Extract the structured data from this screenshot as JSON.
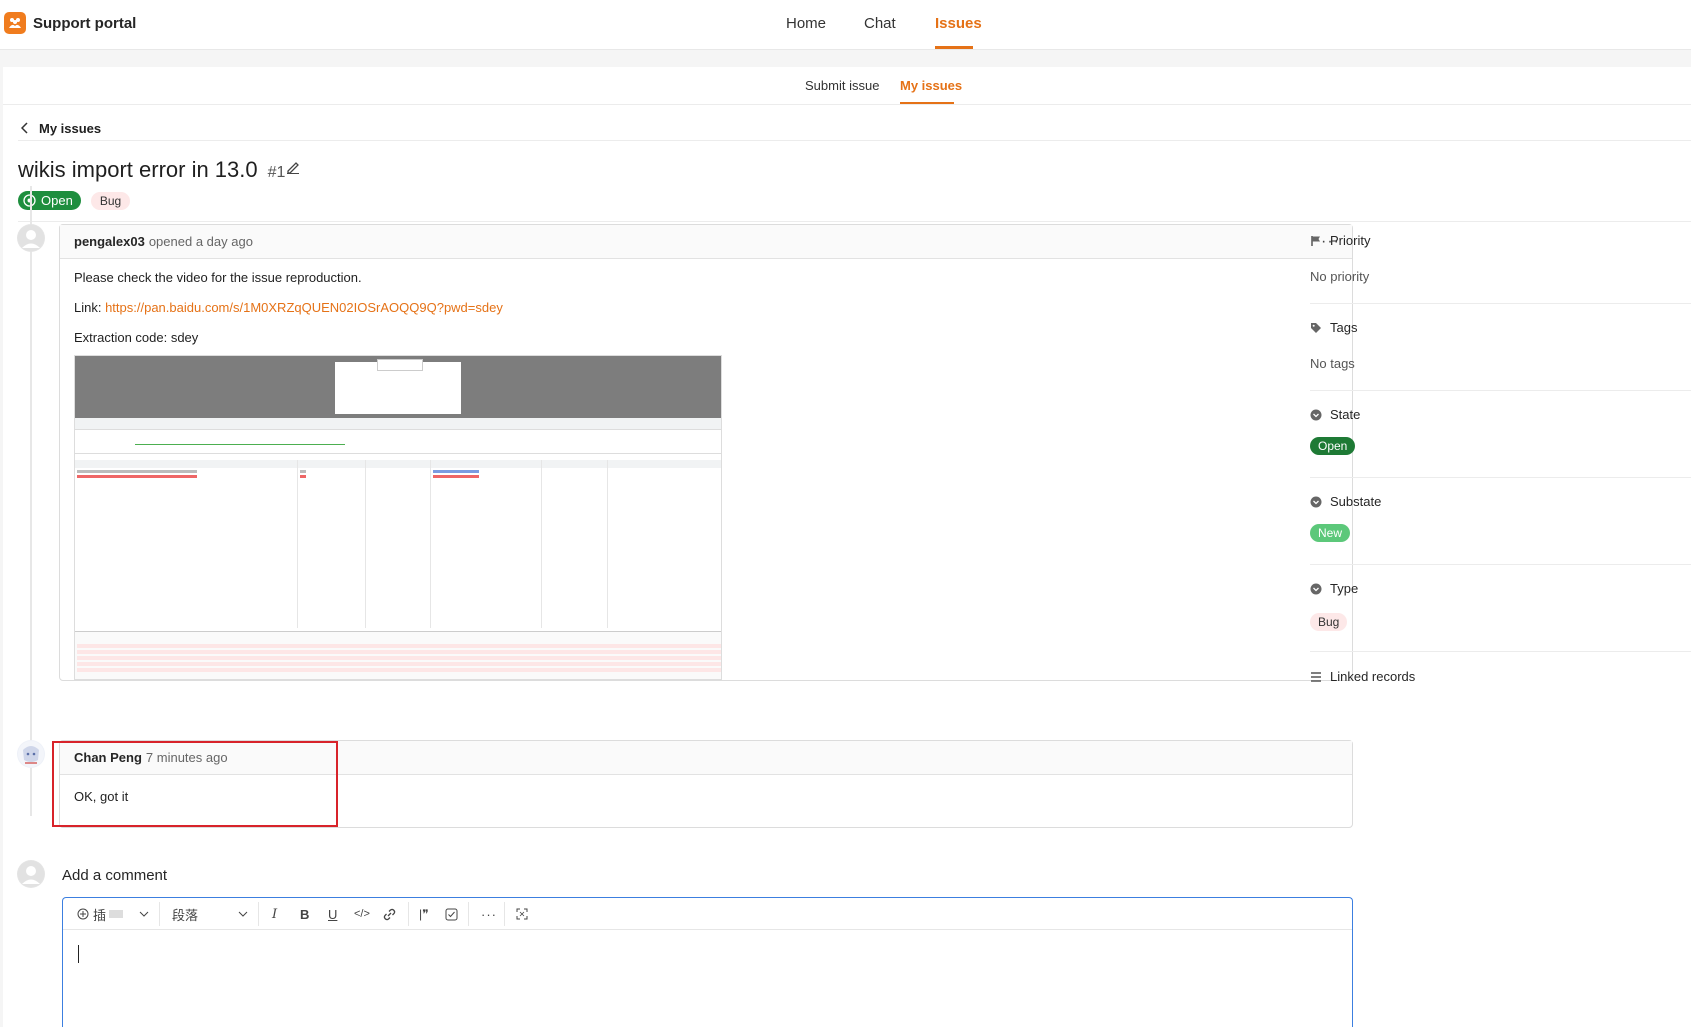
{
  "app": {
    "title": "Support portal"
  },
  "topnav": [
    {
      "label": "Home",
      "active": false
    },
    {
      "label": "Chat",
      "active": false
    },
    {
      "label": "Issues",
      "active": true
    }
  ],
  "subnav": [
    {
      "label": "Submit issue",
      "active": false
    },
    {
      "label": "My issues",
      "active": true
    }
  ],
  "back": {
    "label": "My issues"
  },
  "issue": {
    "title": "wikis import error in 13.0",
    "number": "#1",
    "status": "Open",
    "label": "Bug"
  },
  "comments": [
    {
      "author": "pengalex03",
      "meta": "opened a day ago",
      "line1": "Please check the video for the issue reproduction.",
      "link_prefix": "Link: ",
      "link_text": "https://pan.baidu.com/s/1M0XRZqQUEN02IOSrAOQQ9Q?pwd=sdey",
      "line3": "Extraction code: sdey"
    },
    {
      "author": "Chan Peng",
      "meta": "7 minutes ago",
      "body": "OK, got it"
    }
  ],
  "composer": {
    "label": "Add a comment",
    "insert_label": "插",
    "paragraph_label": "段落"
  },
  "sidebar": {
    "priority": {
      "label": "Priority",
      "value": "No priority"
    },
    "tags": {
      "label": "Tags",
      "value": "No tags"
    },
    "state": {
      "label": "State",
      "value": "Open"
    },
    "substate": {
      "label": "Substate",
      "value": "New"
    },
    "type": {
      "label": "Type",
      "value": "Bug"
    },
    "linked": {
      "label": "Linked records"
    }
  },
  "colors": {
    "accent": "#e57217",
    "open_green": "#1e8e3e",
    "new_green": "#5cc87a",
    "bug_pink": "#fde8e8",
    "highlight_red": "#d8232a"
  }
}
